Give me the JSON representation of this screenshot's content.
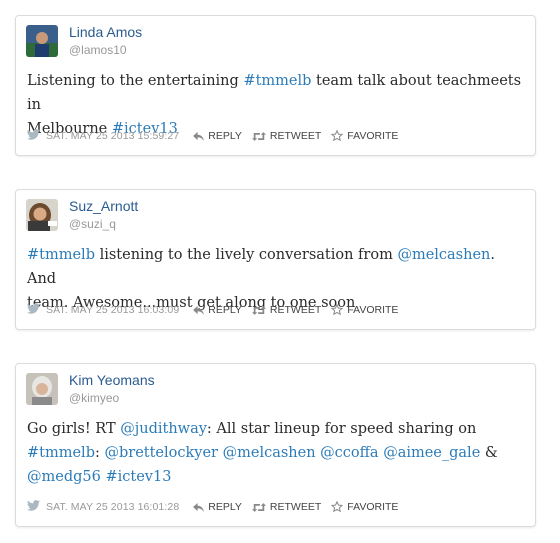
{
  "tweets": [
    {
      "name": "Linda Amos",
      "handle": "@lamos10",
      "text_lines": [
        [
          {
            "t": "Listening to the entertaining "
          },
          {
            "t": "#tmmelb",
            "link": true
          },
          {
            "t": " team talk about teachmeets in"
          }
        ],
        [
          {
            "t": "Melbourne "
          },
          {
            "t": "#ictev13",
            "link": true
          }
        ]
      ],
      "date": "SAT. MAY 25 2013 15:59:27"
    },
    {
      "name": "Suz_Arnott",
      "handle": "@suzi_q",
      "text_lines": [
        [
          {
            "t": "#tmmelb",
            "link": true
          },
          {
            "t": " listening to the lively conversation from "
          },
          {
            "t": "@melcashen",
            "link": true
          },
          {
            "t": ". And"
          }
        ],
        [
          {
            "t": "team. Awesome...must get along to one soon"
          }
        ]
      ],
      "date": "SAT. MAY 25 2013 16:03:09"
    },
    {
      "name": "Kim Yeomans",
      "handle": "@kimyeo",
      "text_lines": [
        [
          {
            "t": "Go girls! RT "
          },
          {
            "t": "@judithway",
            "link": true
          },
          {
            "t": ": All star lineup for speed sharing on"
          }
        ],
        [
          {
            "t": "#tmmelb",
            "link": true
          },
          {
            "t": ": "
          },
          {
            "t": "@brettelockyer",
            "link": true
          },
          {
            "t": " "
          },
          {
            "t": "@melcashen",
            "link": true
          },
          {
            "t": " "
          },
          {
            "t": "@ccoffa",
            "link": true
          },
          {
            "t": " "
          },
          {
            "t": "@aimee_gale",
            "link": true
          },
          {
            "t": " &"
          }
        ],
        [
          {
            "t": "@medg56",
            "link": true
          },
          {
            "t": " "
          },
          {
            "t": "#ictev13",
            "link": true
          }
        ]
      ],
      "date": "SAT. MAY 25 2013 16:01:28"
    }
  ],
  "actions": {
    "reply": "REPLY",
    "retweet": "RETWEET",
    "favorite": "FAVORITE"
  },
  "colors": {
    "name": "#2b5b8f",
    "link": "#2b7bb9",
    "bird": "#aab8c2"
  }
}
